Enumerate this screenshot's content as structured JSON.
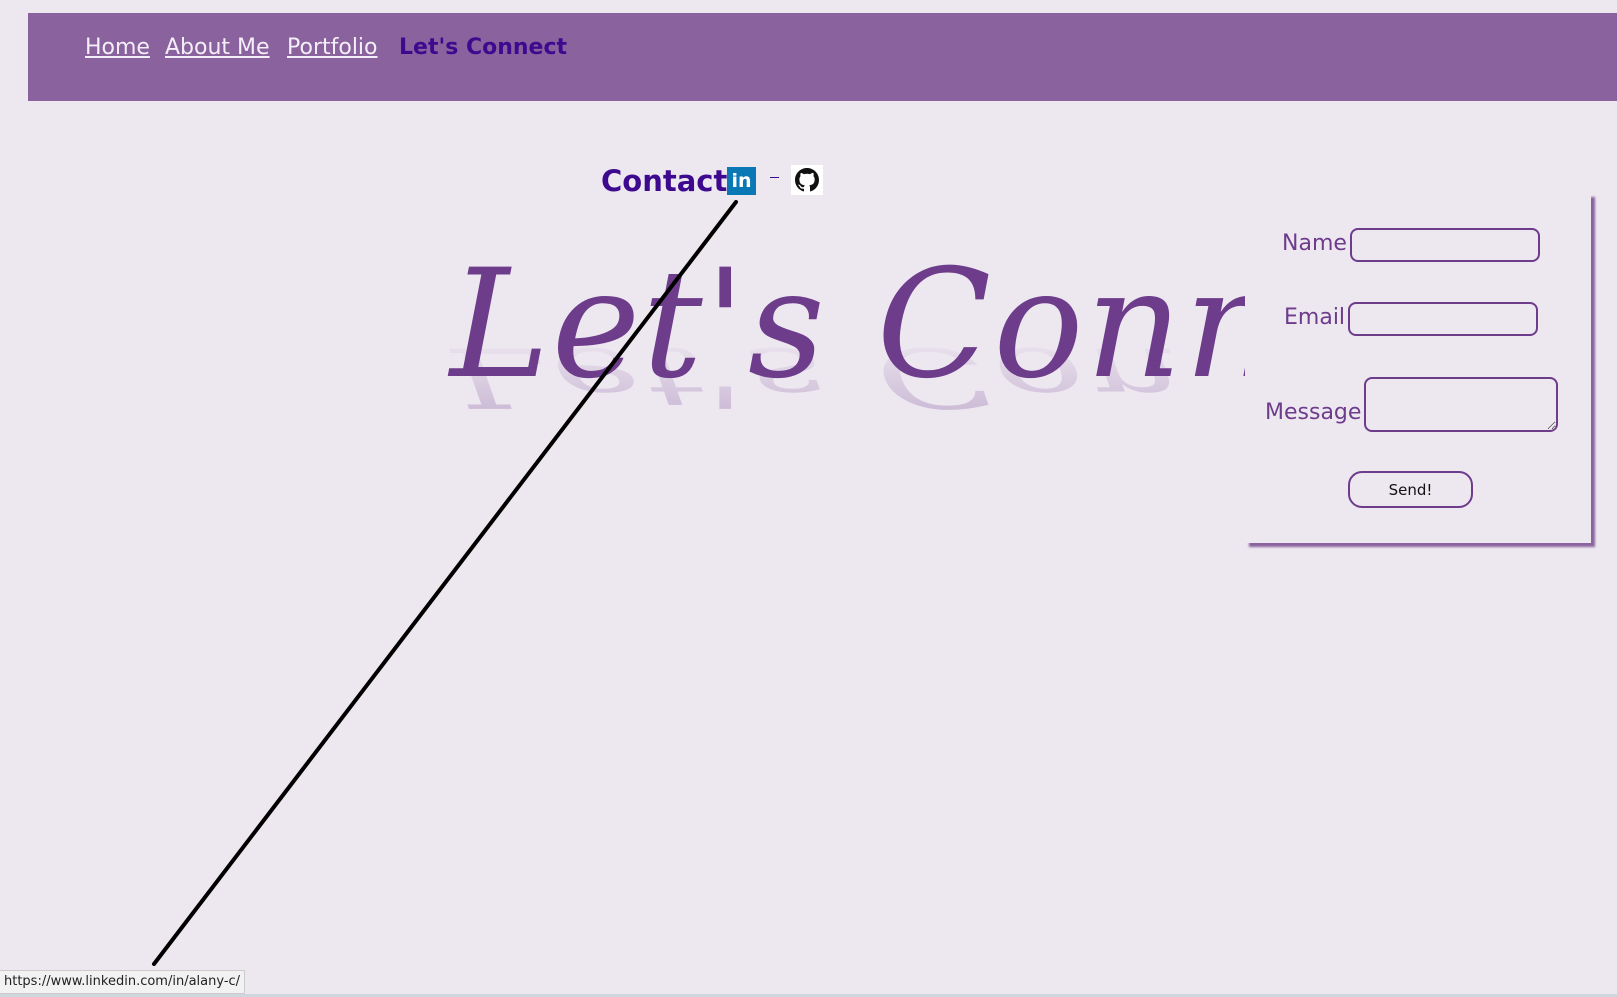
{
  "nav": {
    "items": [
      {
        "label": "Home"
      },
      {
        "label": "About Me"
      },
      {
        "label": "Portfolio"
      },
      {
        "label": "Let's Connect"
      }
    ]
  },
  "contact": {
    "title": "Contact",
    "linkedin_icon_text": "in",
    "icons": [
      "linkedin-icon",
      "github-icon"
    ]
  },
  "hero": {
    "title": "Let's Connect"
  },
  "form": {
    "name_label": "Name",
    "email_label": "Email",
    "message_label": "Message",
    "name_value": "",
    "email_value": "",
    "message_value": "",
    "send_label": "Send!"
  },
  "status_bar": {
    "url": "https://www.linkedin.com/in/alany-c/"
  },
  "colors": {
    "page_bg": "#ede7f0",
    "nav_bg": "#8a639e",
    "accent": "#3d0a8f",
    "form_text": "#6d3c8b",
    "linkedin": "#0a78b5"
  }
}
